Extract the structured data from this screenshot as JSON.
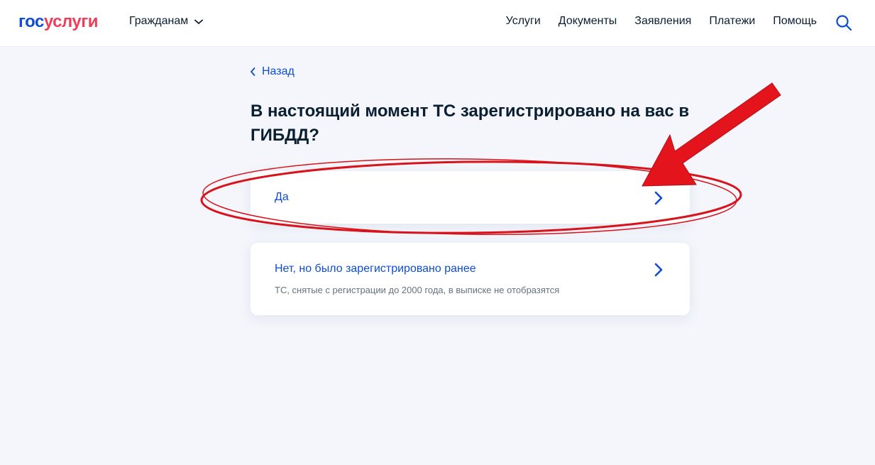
{
  "header": {
    "logo_part1": "гос",
    "logo_part2": "услуги",
    "audience_label": "Гражданам",
    "nav": [
      "Услуги",
      "Документы",
      "Заявления",
      "Платежи",
      "Помощь"
    ]
  },
  "back_label": "Назад",
  "question": "В настоящий момент ТС зарегистрировано на вас в ГИБДД?",
  "options": [
    {
      "label": "Да",
      "hint": ""
    },
    {
      "label": "Нет, но было зарегистрировано ранее",
      "hint": "ТС, снятые с регистрации до 2000 года, в выписке не отобразятся"
    }
  ],
  "colors": {
    "brand_blue": "#0d4cd3",
    "brand_red": "#ee3f58",
    "annotation_red": "#e3141c"
  },
  "icons": [
    "chevron-down-icon",
    "search-icon",
    "chevron-left-icon",
    "chevron-right-icon"
  ]
}
